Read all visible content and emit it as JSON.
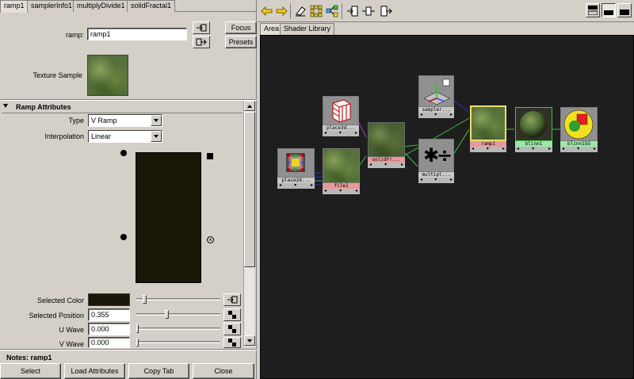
{
  "attr_editor": {
    "tabs": [
      "ramp1",
      "samplerInfo1",
      "multiplyDivide1",
      "solidFractal1"
    ],
    "active_tab": "ramp1",
    "ramp_label": "ramp:",
    "ramp_name": "ramp1",
    "focus_button": "Focus",
    "presets_button": "Presets",
    "texture_sample_label": "Texture Sample",
    "section_title": "Ramp Attributes",
    "type_label": "Type",
    "type_value": "V Ramp",
    "interpolation_label": "Interpolation",
    "interpolation_value": "Linear",
    "selected_color_label": "Selected Color",
    "selected_color": "#1a1608",
    "selected_position_label": "Selected Position",
    "selected_position_value": "0.355",
    "selected_position_slider": 0.355,
    "u_wave_label": "U Wave",
    "u_wave_value": "0.000",
    "v_wave_label": "V Wave",
    "v_wave_value": "0.000",
    "notes_label": "Notes: ramp1",
    "bottom_buttons": [
      "Select",
      "Load Attributes",
      "Copy Tab",
      "Close"
    ]
  },
  "hypershade": {
    "tabs": [
      "Area",
      "Shader Library"
    ],
    "active_tab": "Area",
    "toolbar_icons": [
      "arrow-left-icon",
      "arrow-right-icon",
      "eraser-icon",
      "grid-icon",
      "graph-icon",
      "input-connections-icon",
      "input-output-connections-icon",
      "output-connections-icon"
    ],
    "layout_icons": [
      "layout-top-icon",
      "layout-split-icon",
      "layout-bottom-icon"
    ],
    "nodes": [
      {
        "label": "place3d...",
        "kind": "place3d"
      },
      {
        "label": "place2d...",
        "kind": "place2d"
      },
      {
        "label": "file2",
        "kind": "file"
      },
      {
        "label": "solidFr...",
        "kind": "solidFractal"
      },
      {
        "label": "sampler...",
        "kind": "samplerInfo"
      },
      {
        "label": "multipl...",
        "kind": "multiplyDivide"
      },
      {
        "label": "ramp1",
        "kind": "ramp"
      },
      {
        "label": "blinn1",
        "kind": "blinn"
      },
      {
        "label": "blinn1SG",
        "kind": "shadingGroup"
      }
    ]
  },
  "colors": {
    "canvas_bg": "#1e1e1e",
    "texture_label": "#e89a9a",
    "shader_label": "#9ae8a8",
    "utility_label": "#c8c8c8",
    "selected_border": "#e8e070"
  }
}
